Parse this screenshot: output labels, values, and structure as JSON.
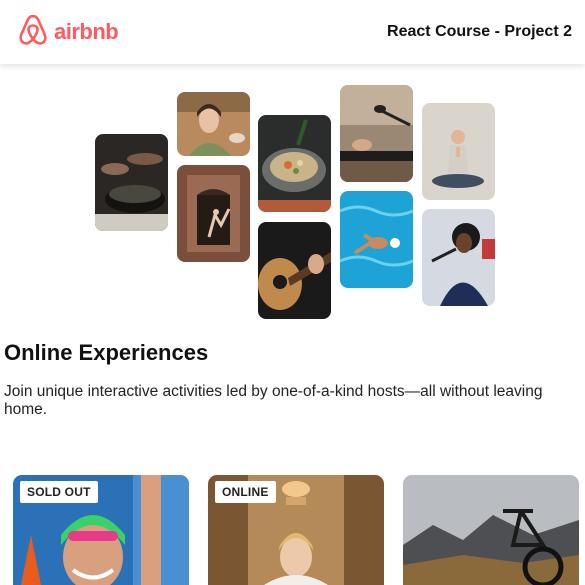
{
  "navbar": {
    "brand": "airbnb",
    "title": "React Course - Project 2",
    "brand_color": "#FF5A5F"
  },
  "gallery": {
    "photos": [
      "cooking",
      "woman-smiling",
      "doorway-dancer",
      "food-bowl",
      "guitar",
      "microphone",
      "swimmer",
      "yoga",
      "singer"
    ]
  },
  "hero": {
    "title": "Online Experiences",
    "text": "Join unique interactive activities led by one-of-a-kind hosts—all without leaving home."
  },
  "cards": [
    {
      "badge": "SOLD OUT",
      "image": "swimmer-portrait"
    },
    {
      "badge": "ONLINE",
      "image": "bride-portrait"
    },
    {
      "badge": "",
      "image": "mountain-bike"
    }
  ]
}
